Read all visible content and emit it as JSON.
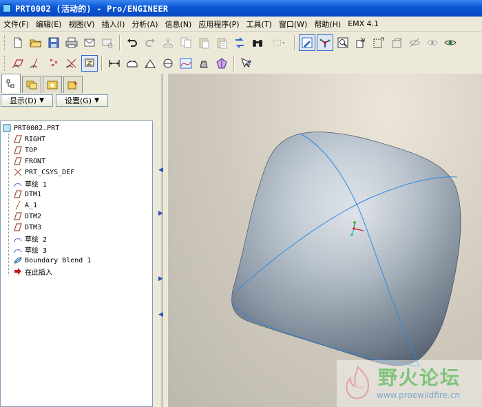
{
  "window": {
    "title": "PRT0002 (活动的) - Pro/ENGINEER"
  },
  "menu": {
    "items": [
      "文件(F)",
      "编辑(E)",
      "视图(V)",
      "插入(I)",
      "分析(A)",
      "信息(N)",
      "应用程序(P)",
      "工具(T)",
      "窗口(W)",
      "帮助(H)",
      "EMX 4.1"
    ]
  },
  "panel": {
    "show_label": "显示(D)",
    "settings_label": "设置(G)"
  },
  "tree": {
    "items": [
      {
        "label": "PRT0002.PRT",
        "icon": "part-icon"
      },
      {
        "label": "RIGHT",
        "icon": "datum-plane-icon"
      },
      {
        "label": "TOP",
        "icon": "datum-plane-icon"
      },
      {
        "label": "FRONT",
        "icon": "datum-plane-icon"
      },
      {
        "label": "PRT_CSYS_DEF",
        "icon": "csys-icon"
      },
      {
        "label": "草绘 1",
        "icon": "sketch-icon"
      },
      {
        "label": "DTM1",
        "icon": "datum-plane-icon"
      },
      {
        "label": "A_1",
        "icon": "datum-axis-icon"
      },
      {
        "label": "DTM2",
        "icon": "datum-plane-icon"
      },
      {
        "label": "DTM3",
        "icon": "datum-plane-icon"
      },
      {
        "label": "草绘 2",
        "icon": "sketch-icon"
      },
      {
        "label": "草绘 3",
        "icon": "sketch-icon"
      },
      {
        "label": "Boundary Blend 1",
        "icon": "boundary-blend-icon"
      },
      {
        "label": "在此插入",
        "icon": "insert-arrow-icon"
      }
    ]
  },
  "watermark": {
    "text": "野火论坛",
    "url": "www.proewildfire.cn"
  },
  "colors": {
    "titlebar": "#0a57d6",
    "chrome": "#ece9d8",
    "edge_curve": "#2a8ae6"
  }
}
